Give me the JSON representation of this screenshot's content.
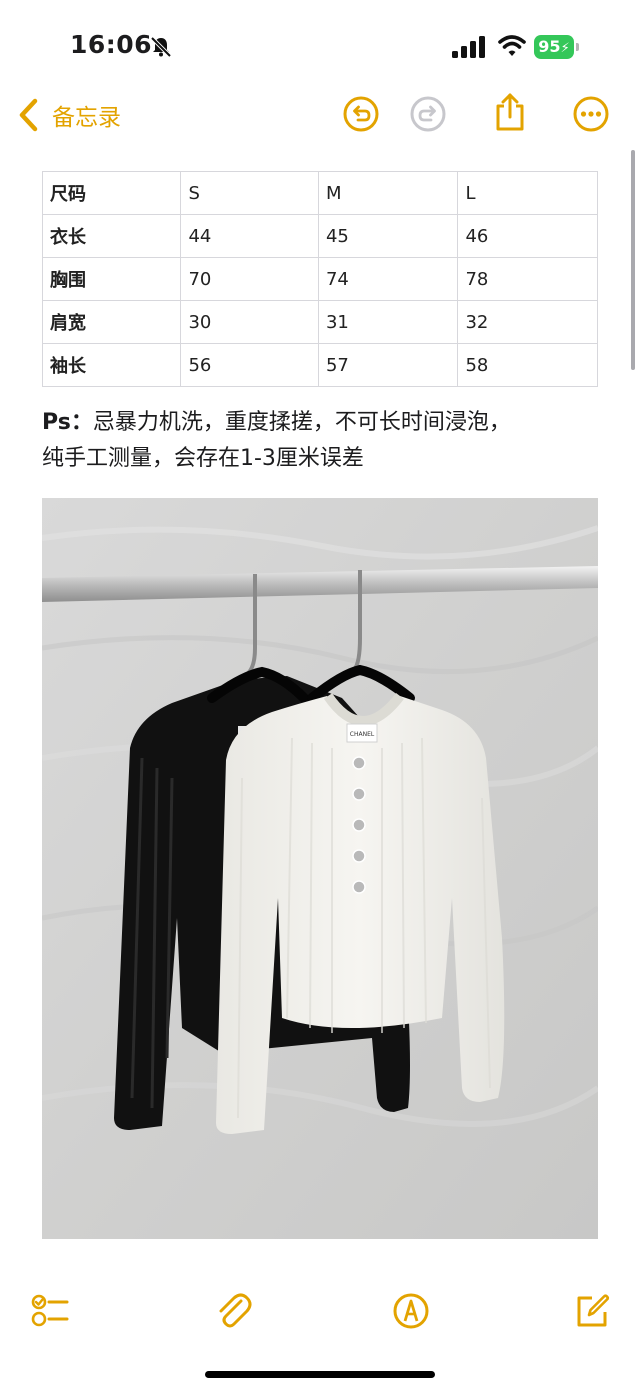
{
  "status_bar": {
    "time": "16:06",
    "silent_icon": "bell-slash-icon",
    "signal_icon": "cellular-signal-icon",
    "wifi_icon": "wifi-icon",
    "battery_level": "95",
    "battery_color": "#34c759"
  },
  "nav": {
    "back_label": "备忘录",
    "back_icon": "chevron-left-icon",
    "undo_icon": "undo-icon",
    "redo_icon": "redo-icon",
    "share_icon": "share-icon",
    "more_icon": "ellipsis-circle-icon",
    "accent_color": "#e3a300",
    "redo_enabled": false
  },
  "size_table": {
    "header": [
      "尺码",
      "S",
      "M",
      "L"
    ],
    "rows": [
      [
        "衣长",
        "44",
        "45",
        "46"
      ],
      [
        "胸围",
        "70",
        "74",
        "78"
      ],
      [
        "肩宽",
        "30",
        "31",
        "32"
      ],
      [
        "袖长",
        "56",
        "57",
        "58"
      ]
    ]
  },
  "note": {
    "prefix": "Ps：",
    "line1": "忌暴力机洗，重度揉搓，不可长时间浸泡，",
    "line2": "纯手工测量，会存在1-3厘米误差"
  },
  "photo": {
    "label_text": "CHANEL",
    "subject": "sweater-photo"
  },
  "toolbar": {
    "checklist_icon": "checklist-icon",
    "attachment_icon": "paperclip-icon",
    "markup_icon": "pen-circle-icon",
    "compose_icon": "compose-icon"
  }
}
